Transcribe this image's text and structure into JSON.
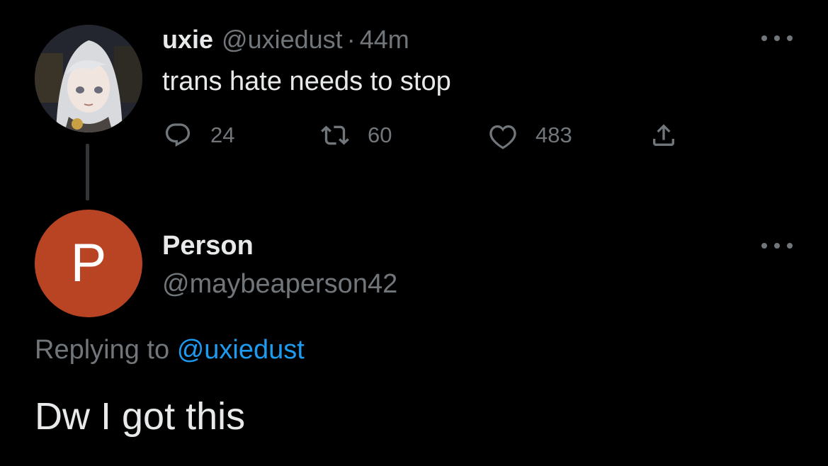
{
  "parent_tweet": {
    "display_name": "uxie",
    "handle": "@uxiedust",
    "separator": "·",
    "time": "44m",
    "text": "trans hate needs to stop",
    "replies": "24",
    "retweets": "60",
    "likes": "483",
    "avatar": "anime-character-avatar"
  },
  "reply_tweet": {
    "display_name": "Person",
    "handle": "@maybeaperson42",
    "avatar_letter": "P",
    "avatar_color": "#b84424",
    "replying_label": "Replying to",
    "replying_to": "@uxiedust",
    "text": "Dw I got this"
  },
  "icons": {
    "reply": "speech-bubble-icon",
    "retweet": "retweet-arrows-icon",
    "like": "heart-icon",
    "share": "share-upload-icon",
    "more": "more-dots-icon"
  },
  "colors": {
    "background": "#000000",
    "primary_text": "#e7e9ea",
    "secondary_text": "#71767b",
    "link": "#1d9bf0"
  }
}
